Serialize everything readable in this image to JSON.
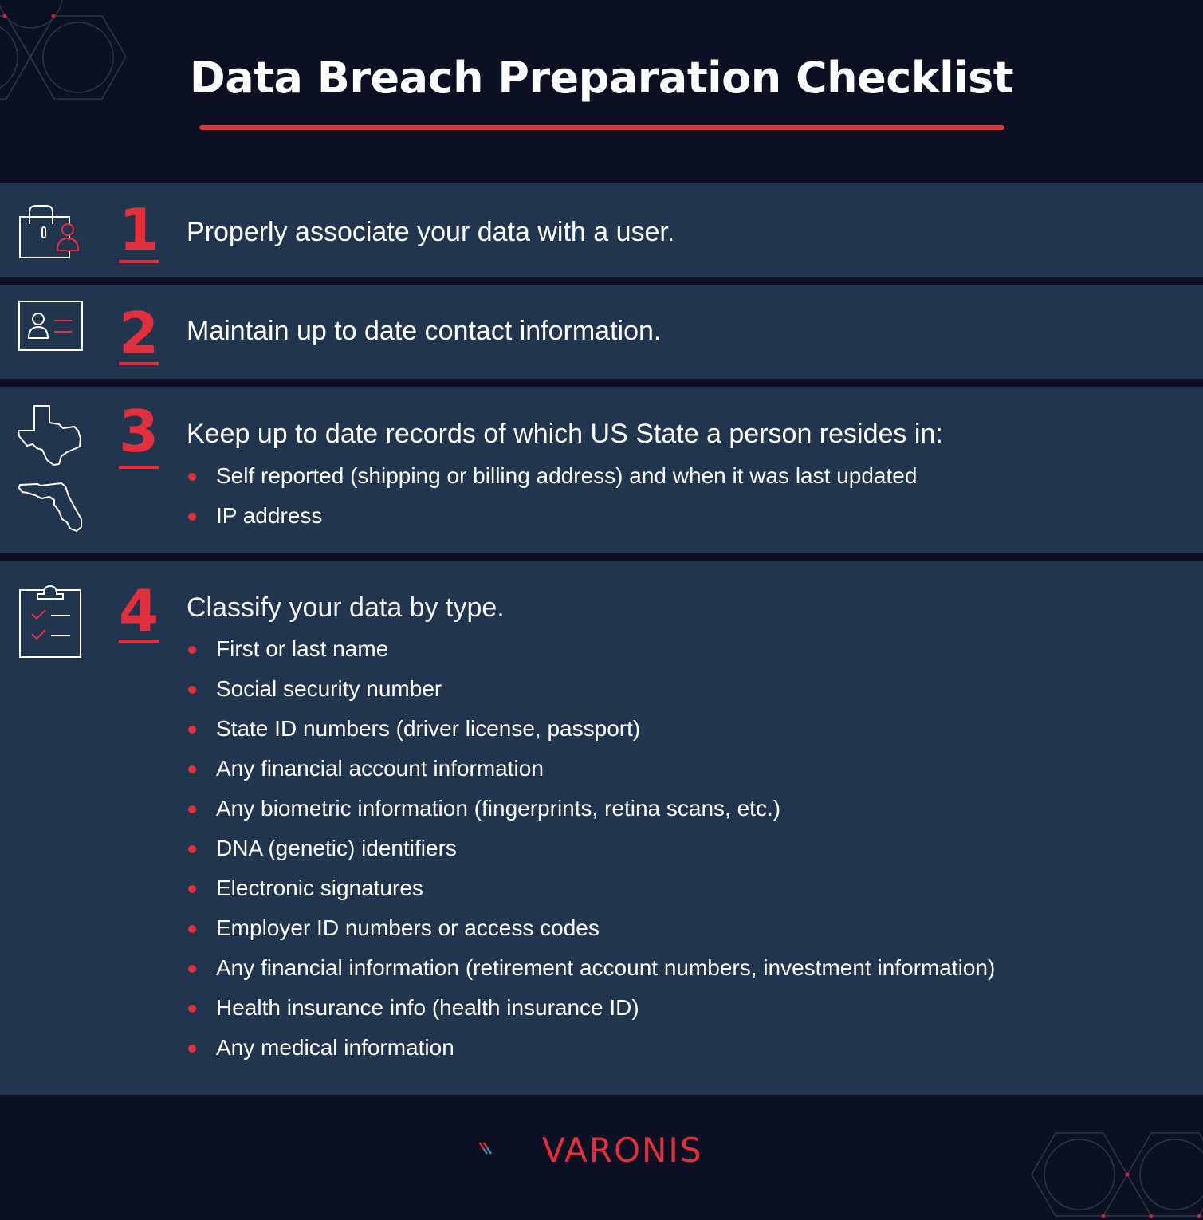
{
  "title": "Data Breach Preparation Checklist",
  "colors": {
    "background": "#0d0f22",
    "section": "#21354f",
    "accent": "#e0303d",
    "logo_teal": "#1fa5b8",
    "text": "#ffffff"
  },
  "sections": [
    {
      "number": "1",
      "icon": "padlock-user-icon",
      "heading": "Properly associate your data with a user.",
      "bullets": []
    },
    {
      "number": "2",
      "icon": "contact-card-icon",
      "heading": "Maintain up to date contact information.",
      "bullets": []
    },
    {
      "number": "3",
      "icon": "us-states-icon",
      "heading": "Keep up to date records of which US State a person resides in:",
      "bullets": [
        "Self reported (shipping or billing address) and when it was last updated",
        "IP address"
      ]
    },
    {
      "number": "4",
      "icon": "clipboard-checklist-icon",
      "heading": "Classify your data by type.",
      "bullets": [
        "First or last name",
        "Social security number",
        "State ID numbers (driver license, passport)",
        "Any financial account information",
        "Any biometric information (fingerprints, retina scans, etc.)",
        "DNA (genetic) identifiers",
        "Electronic signatures",
        "Employer ID numbers or access codes",
        "Any financial information (retirement account numbers, investment information)",
        "Health insurance info (health insurance ID)",
        "Any medical information"
      ]
    }
  ],
  "footer": {
    "logo_text": "VARONIS"
  }
}
